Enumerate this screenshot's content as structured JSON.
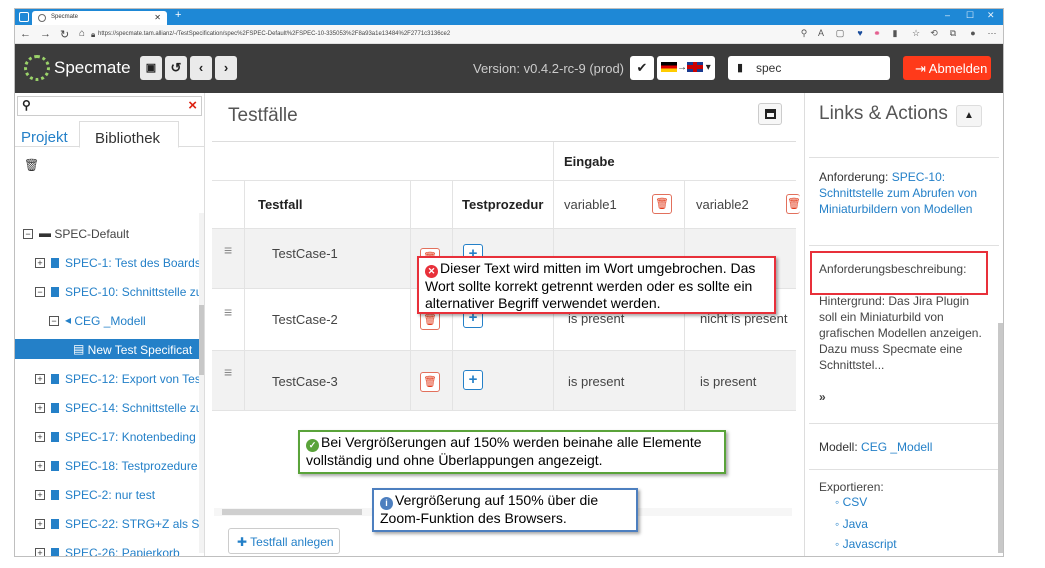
{
  "browser": {
    "tab_title": "Specmate",
    "url": "https://specmate.tam.allianz/-/TestSpecification/spec%2FSPEC-Default%2FSPEC-10-335053%2F8a93a1e13484%2F2771c3136ce2"
  },
  "header": {
    "app_name": "Specmate",
    "version": "Version: v0.4.2-rc-9 (prod)",
    "project": "spec",
    "logout": "Abmelden"
  },
  "left": {
    "tabs": [
      "Projekt",
      "Bibliothek"
    ],
    "tree": [
      {
        "label": "SPEC-Default",
        "level": 0,
        "kind": "folder"
      },
      {
        "label": "SPEC-1: Test des Boards",
        "level": 1,
        "kind": "doc"
      },
      {
        "label": "SPEC-10: Schnittstelle zu",
        "level": 1,
        "kind": "doc"
      },
      {
        "label": "CEG _Modell",
        "level": 2,
        "kind": "ceg"
      },
      {
        "label": "New Test Specificat",
        "level": 3,
        "kind": "spec",
        "selected": true
      },
      {
        "label": "SPEC-12: Export von Tes",
        "level": 1,
        "kind": "doc"
      },
      {
        "label": "SPEC-14: Schnittstelle zu",
        "level": 1,
        "kind": "doc"
      },
      {
        "label": "SPEC-17: Knotenbeding",
        "level": 1,
        "kind": "doc"
      },
      {
        "label": "SPEC-18: Testprozedure",
        "level": 1,
        "kind": "doc"
      },
      {
        "label": "SPEC-2: nur test",
        "level": 1,
        "kind": "doc"
      },
      {
        "label": "SPEC-22: STRG+Z als Sh",
        "level": 1,
        "kind": "doc"
      },
      {
        "label": "SPEC-26: Papierkorb",
        "level": 1,
        "kind": "doc"
      }
    ]
  },
  "main": {
    "title": "Testfälle",
    "group_header": "Eingabe",
    "columns": [
      "Testfall",
      "Testprozedur",
      "variable1",
      "variable2"
    ],
    "rows": [
      {
        "name": "TestCase-1",
        "v1": "",
        "v2": ""
      },
      {
        "name": "TestCase-2",
        "v1": "is present",
        "v2": "nicht is present"
      },
      {
        "name": "TestCase-3",
        "v1": "is present",
        "v2": "is present"
      }
    ],
    "add_testcase": "Testfall anlegen"
  },
  "right": {
    "title": "Links & Actions",
    "req_label": "Anforderung:",
    "req_link": "SPEC-10: Schnittstelle zum Abrufen von Miniaturbildern von Modellen",
    "desc_label": "Anforderungsbeschreibung:",
    "desc_text": "Hintergrund: Das Jira Plugin soll ein Miniaturbild von grafischen Modellen anzeigen. Dazu muss Specmate eine Schnittstel...",
    "more": "»",
    "model_label": "Modell:",
    "model_link": "CEG _Modell",
    "export_label": "Exportieren:",
    "export_items": [
      "CSV",
      "Java",
      "Javascript"
    ]
  },
  "callouts": {
    "red": "Dieser Text wird mitten im Wort umgebrochen. Das Wort sollte korrekt getrennt werden oder es sollte ein alternativer Begriff verwendet werden.",
    "green": "Bei Vergrößerungen auf 150% werden beinahe alle Elemente vollständig und ohne Überlappungen angezeigt.",
    "blue": "Vergrößerung auf 150% über die Zoom-Funktion des Browsers."
  },
  "colors": {
    "accent": "#2480c8",
    "danger": "#ff3a1a",
    "header_bg": "#3c3c3c",
    "tabbar": "#1e88d6"
  }
}
